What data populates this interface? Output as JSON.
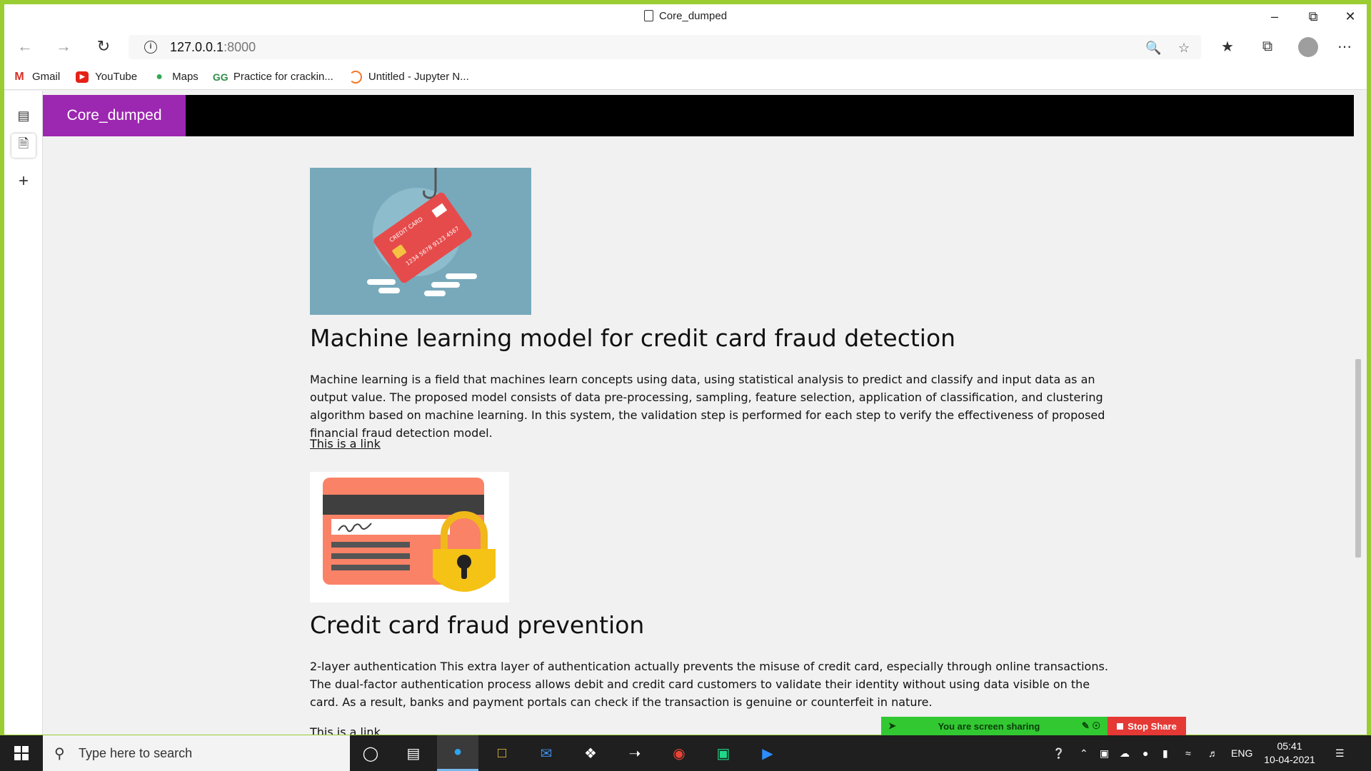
{
  "browser": {
    "tab_title": "Core_dumped",
    "url_host": "127.0.0.1",
    "url_port": ":8000",
    "bookmarks": [
      {
        "label": "Gmail",
        "icon": "gmail-icon"
      },
      {
        "label": "YouTube",
        "icon": "youtube-icon"
      },
      {
        "label": "Maps",
        "icon": "maps-icon"
      },
      {
        "label": "Practice for crackin...",
        "icon": "geeksforgeeks-icon"
      },
      {
        "label": "Untitled - Jupyter N...",
        "icon": "jupyter-icon"
      }
    ]
  },
  "site": {
    "brand": "Core_dumped",
    "brand_color": "#9c27b0",
    "sections": [
      {
        "title": "Machine learning model for credit card fraud detection",
        "body": "Machine learning is a field that machines learn concepts using data, using statistical analysis to predict and classify and input data as an output value. The proposed model consists of data pre-processing, sampling, feature selection, application of classification, and clustering algorithm based on machine learning. In this system, the validation step is performed for each step to verify the effectiveness of proposed financial fraud detection model.",
        "link": "This is a link",
        "image_card_text": "CREDIT CARD",
        "image_card_number": "1234 5678 9123 4567"
      },
      {
        "title": "Credit card fraud prevention",
        "body": "2-layer authentication This extra layer of authentication actually prevents the misuse of credit card, especially through online transactions. The dual-factor authentication process allows debit and credit card customers to validate their identity without using data visible on the card. As a result, banks and payment portals can check if the transaction is genuine or counterfeit in nature.",
        "link": "This is a link"
      }
    ]
  },
  "screen_share": {
    "status": "You are screen sharing",
    "stop_label": "Stop Share"
  },
  "taskbar": {
    "search_placeholder": "Type here to search",
    "language": "ENG",
    "time": "05:41",
    "date": "10-04-2021"
  }
}
